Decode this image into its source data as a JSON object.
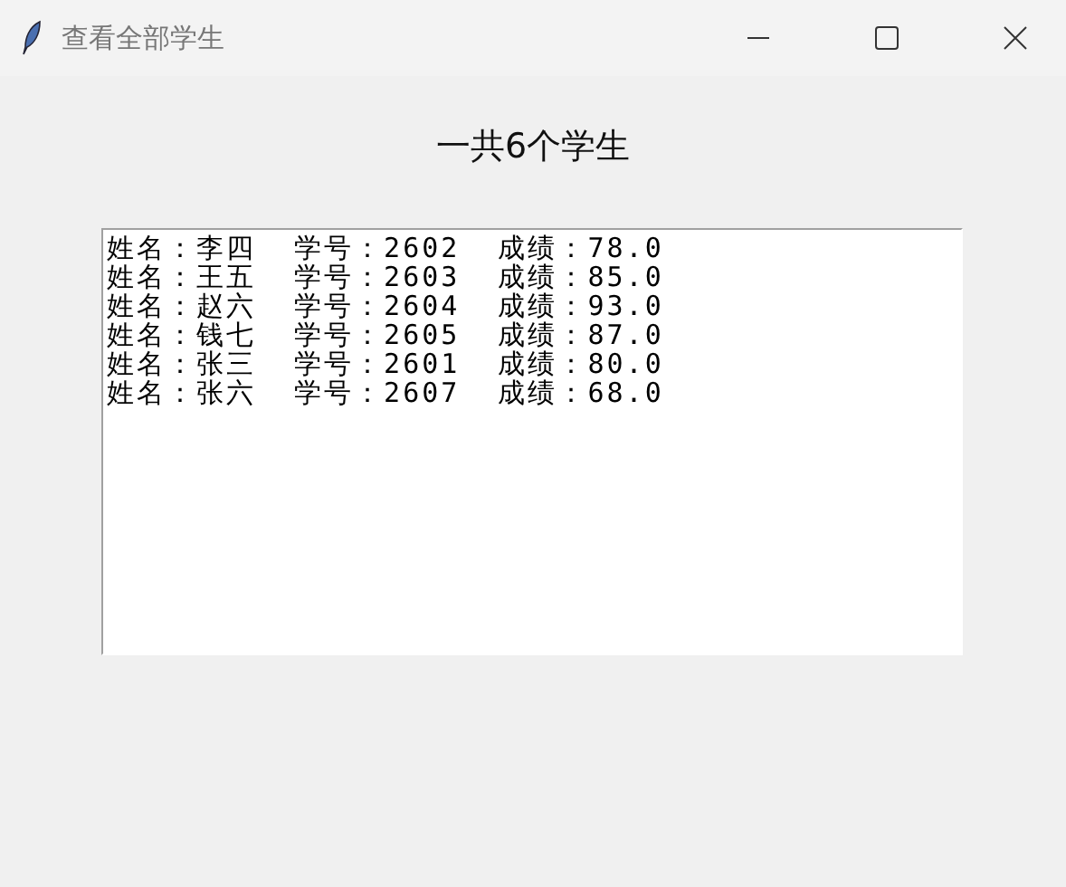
{
  "window": {
    "title": "查看全部学生"
  },
  "heading": "一共6个学生",
  "lines": [
    "姓名：李四  学号：2602  成绩：78.0",
    "姓名：王五  学号：2603  成绩：85.0",
    "姓名：赵六  学号：2604  成绩：93.0",
    "姓名：钱七  学号：2605  成绩：87.0",
    "姓名：张三  学号：2601  成绩：80.0",
    "姓名：张六  学号：2607  成绩：68.0"
  ]
}
